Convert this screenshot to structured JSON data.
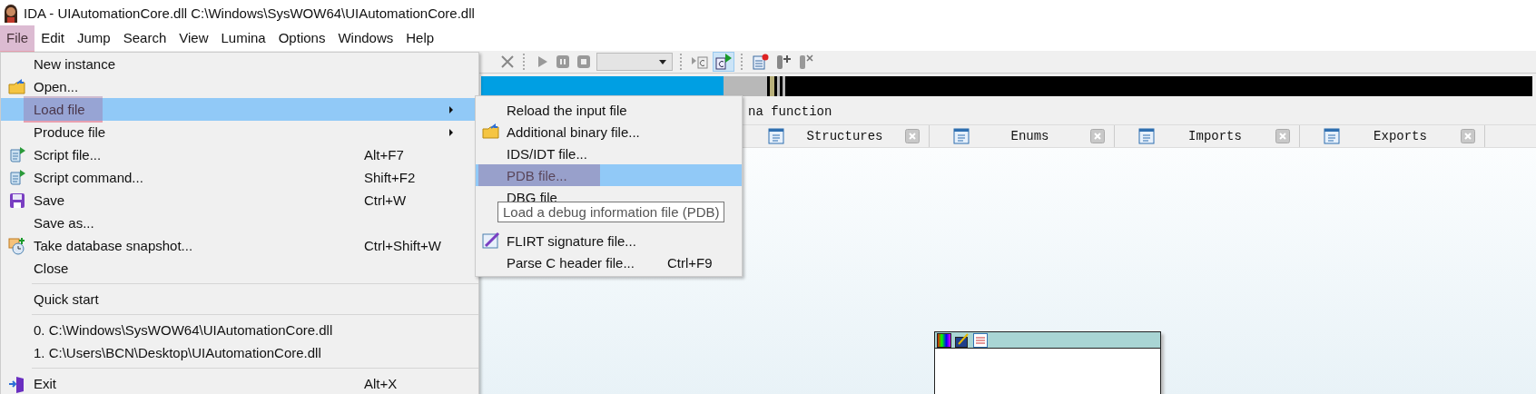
{
  "window": {
    "title": "IDA - UIAutomationCore.dll C:\\Windows\\SysWOW64\\UIAutomationCore.dll"
  },
  "menubar": [
    {
      "label": "File",
      "selected": true,
      "annotated": true
    },
    {
      "label": "Edit",
      "selected": false,
      "annotated": false
    },
    {
      "label": "Jump",
      "selected": false,
      "annotated": false
    },
    {
      "label": "Search",
      "selected": false,
      "annotated": false
    },
    {
      "label": "View",
      "selected": false,
      "annotated": false
    },
    {
      "label": "Lumina",
      "selected": false,
      "annotated": false
    },
    {
      "label": "Options",
      "selected": false,
      "annotated": false
    },
    {
      "label": "Windows",
      "selected": false,
      "annotated": false
    },
    {
      "label": "Help",
      "selected": false,
      "annotated": false
    }
  ],
  "status_text": "na function",
  "tabs": [
    {
      "label": "Structures"
    },
    {
      "label": "Enums"
    },
    {
      "label": "Imports"
    },
    {
      "label": "Exports"
    }
  ],
  "file_menu": {
    "items": [
      {
        "kind": "item",
        "label": "New instance",
        "selected": false,
        "annotated": false,
        "submenu": false
      },
      {
        "kind": "item",
        "label": "Open...",
        "selected": false,
        "annotated": false,
        "submenu": false
      },
      {
        "kind": "item",
        "label": "Load file",
        "selected": true,
        "annotated": true,
        "submenu": true
      },
      {
        "kind": "item",
        "label": "Produce file",
        "selected": false,
        "annotated": false,
        "submenu": true
      },
      {
        "kind": "item",
        "label": "Script file...",
        "shortcut": "Alt+F7",
        "selected": false,
        "annotated": false,
        "submenu": false
      },
      {
        "kind": "item",
        "label": "Script command...",
        "shortcut": "Shift+F2",
        "selected": false,
        "annotated": false,
        "submenu": false
      },
      {
        "kind": "item",
        "label": "Save",
        "shortcut": "Ctrl+W",
        "selected": false,
        "annotated": false,
        "submenu": false
      },
      {
        "kind": "item",
        "label": "Save as...",
        "selected": false,
        "annotated": false,
        "submenu": false
      },
      {
        "kind": "item",
        "label": "Take database snapshot...",
        "shortcut": "Ctrl+Shift+W",
        "selected": false,
        "annotated": false,
        "submenu": false
      },
      {
        "kind": "item",
        "label": "Close",
        "selected": false,
        "annotated": false,
        "submenu": false
      },
      {
        "kind": "separator"
      },
      {
        "kind": "item",
        "label": "Quick start",
        "selected": false,
        "annotated": false,
        "submenu": false
      },
      {
        "kind": "separator"
      },
      {
        "kind": "item",
        "label": "0. C:\\Windows\\SysWOW64\\UIAutomationCore.dll",
        "selected": false,
        "annotated": false,
        "submenu": false
      },
      {
        "kind": "item",
        "label": "1. C:\\Users\\BCN\\Desktop\\UIAutomationCore.dll",
        "selected": false,
        "annotated": false,
        "submenu": false
      },
      {
        "kind": "separator"
      },
      {
        "kind": "item",
        "label": "Exit",
        "shortcut": "Alt+X",
        "selected": false,
        "annotated": false,
        "submenu": false
      }
    ]
  },
  "load_file_menu": {
    "items": [
      {
        "kind": "item",
        "label": "Reload the input file",
        "selected": false,
        "annotated": false,
        "submenu": false
      },
      {
        "kind": "item",
        "label": "Additional binary file...",
        "selected": false,
        "annotated": false,
        "submenu": false
      },
      {
        "kind": "item",
        "label": "IDS/IDT file...",
        "selected": false,
        "annotated": false,
        "submenu": false
      },
      {
        "kind": "item",
        "label": "PDB file...",
        "selected": true,
        "annotated": true,
        "submenu": false
      },
      {
        "kind": "item",
        "label": "DBG file",
        "selected": false,
        "annotated": false,
        "submenu": false
      },
      {
        "kind": "item",
        "label": "FLIRT signature file...",
        "selected": false,
        "annotated": false,
        "submenu": false
      },
      {
        "kind": "item",
        "label": "Parse C header file...",
        "shortcut": "Ctrl+F9",
        "selected": false,
        "annotated": false,
        "submenu": false
      }
    ]
  },
  "tooltip": {
    "text": "Load a debug information file (PDB)"
  }
}
